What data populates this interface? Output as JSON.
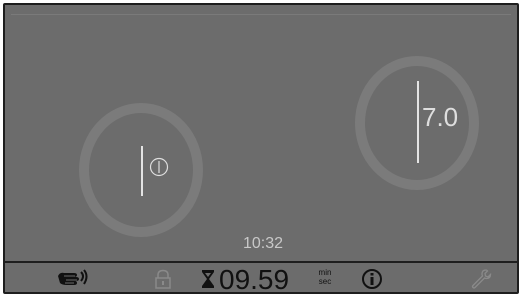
{
  "zones": {
    "left": {
      "power_symbol": "power-standby-icon"
    },
    "right": {
      "level": "7.0"
    }
  },
  "clock": "10:32",
  "status_bar": {
    "wave_icon": "hand-wave-icon",
    "lock_icon": "lock-icon",
    "hourglass_icon": "hourglass-icon",
    "timer_value": "09.59",
    "timer_unit_top": "min",
    "timer_unit_bottom": "sec",
    "info_icon": "info-icon",
    "settings_icon": "wrench-icon"
  },
  "colors": {
    "background": "#6c6c6c",
    "zone_ring": "#7b7b7b",
    "text_light": "#dedede",
    "text_dark": "#111111",
    "muted_icon": "#8a8a8a"
  }
}
